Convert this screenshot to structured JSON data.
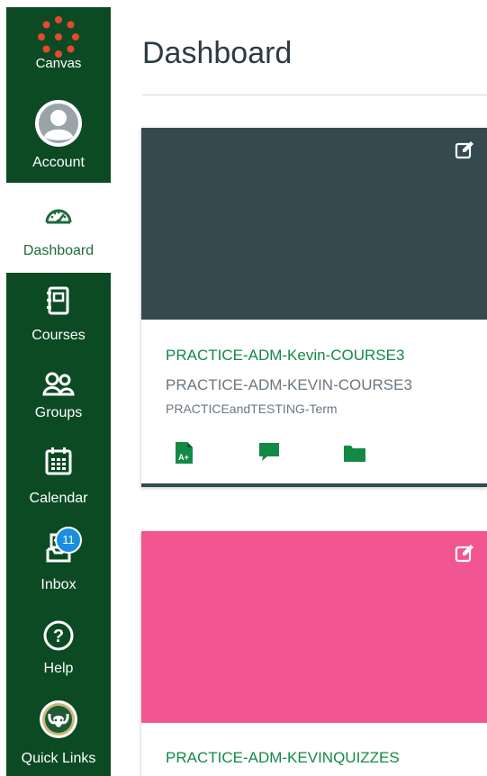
{
  "colors": {
    "nav_bg": "#0c4a24",
    "nav_text": "#ffffff",
    "nav_active": "#1f6a3a",
    "course_link": "#128a46",
    "card1_hero": "#344a4f",
    "card2_hero": "#f25691",
    "badge": "#1a8fe0"
  },
  "nav": {
    "logo_label": "Canvas",
    "account_label": "Account",
    "dashboard_label": "Dashboard",
    "courses_label": "Courses",
    "groups_label": "Groups",
    "calendar_label": "Calendar",
    "inbox_label": "Inbox",
    "inbox_badge": "11",
    "help_label": "Help",
    "quicklinks_label": "Quick Links"
  },
  "main": {
    "title": "Dashboard",
    "cards": [
      {
        "name": "PRACTICE-ADM-Kevin-COURSE3",
        "code": "PRACTICE-ADM-KEVIN-COURSE3",
        "term": "PRACTICEandTESTING-Term",
        "icons": [
          "grades-icon",
          "discussions-icon",
          "files-icon"
        ]
      },
      {
        "name": "PRACTICE-ADM-KEVINQUIZZES"
      }
    ]
  }
}
